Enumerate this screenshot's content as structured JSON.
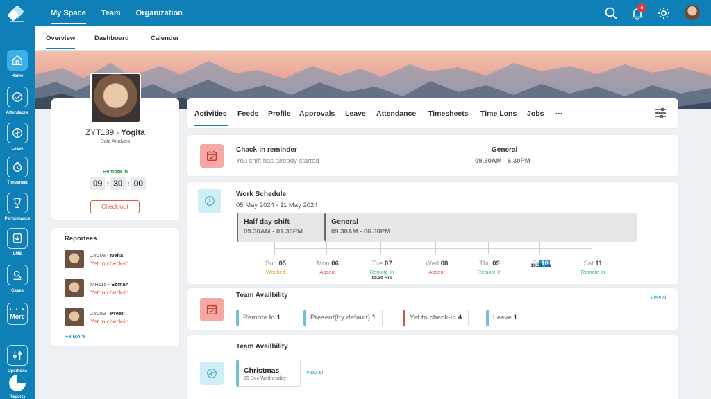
{
  "sidebar": {
    "items": [
      {
        "label": "Home",
        "icon": "home-icon"
      },
      {
        "label": "Attendacne",
        "icon": "attendance-icon"
      },
      {
        "label": "Leave",
        "icon": "leave-icon"
      },
      {
        "label": "Timesheet",
        "icon": "timesheet-icon"
      },
      {
        "label": "Performance",
        "icon": "trophy-icon"
      },
      {
        "label": "LMS",
        "icon": "download-icon"
      },
      {
        "label": "Cases",
        "icon": "cases-icon"
      },
      {
        "label": "More",
        "icon": "more-icon"
      },
      {
        "label": "Opertions",
        "icon": "operations-icon"
      },
      {
        "label": "Reports",
        "icon": "pie-chart-icon"
      }
    ]
  },
  "topnav": {
    "items": [
      "My Space",
      "Team",
      "Organization"
    ],
    "notification_count": "6"
  },
  "subnav": {
    "items": [
      "Overview",
      "Dashboard",
      "Calender"
    ]
  },
  "profile": {
    "id": "ZYT189",
    "separator": " - ",
    "name": "Yogita",
    "role": "Data Analysis",
    "status": "Remote In",
    "clock": {
      "h": "09",
      "m": "30",
      "s": "00"
    },
    "checkout": "Check-out"
  },
  "reportees": {
    "title": "Reportees",
    "people": [
      {
        "id": "ZY208",
        "name": "Neha",
        "status": "Yet to check-in"
      },
      {
        "id": "MH115",
        "name": "Soman",
        "status": "Yet to check-in"
      },
      {
        "id": "ZY289",
        "name": "Preeti",
        "status": "Yet to check-in"
      }
    ],
    "more": "+8 More"
  },
  "tabs": [
    "Activities",
    "Feeds",
    "Profile",
    "Approvals",
    "Leave",
    "Attendance",
    "Timesheets",
    "Time Lons",
    "Jobs",
    "···"
  ],
  "checkin": {
    "title": "Chack-in reminder",
    "subtitle": "You shift has already started",
    "shift_name": "General",
    "shift_time": "09.30AM - 6.30PM"
  },
  "schedule": {
    "title": "Work Schedule",
    "range": "05 May 2024 - 11 May 2024",
    "shifts": [
      {
        "name": "Half day shift",
        "time": "09.30AM - 01.30PM"
      },
      {
        "name": "General",
        "time": "09.30AM - 06.30PM"
      }
    ],
    "days": [
      {
        "dow": "Sun",
        "date": "05",
        "status": "Weeked",
        "hrs": ""
      },
      {
        "dow": "Mon",
        "date": "06",
        "status": "Absent",
        "hrs": ""
      },
      {
        "dow": "Tue",
        "date": "07",
        "status": "Remote In",
        "hrs": "09.30 Hrs"
      },
      {
        "dow": "Wed",
        "date": "08",
        "status": "Absent",
        "hrs": ""
      },
      {
        "dow": "Thu",
        "date": "09",
        "status": "Remote In",
        "hrs": ""
      },
      {
        "dow": "Fri",
        "date": "10",
        "status": "",
        "hrs": "18.30 Hrs"
      },
      {
        "dow": "Sat",
        "date": "11",
        "status": "Remote In",
        "hrs": ""
      }
    ]
  },
  "team": {
    "title": "Team Availbility",
    "view_all": "View all",
    "pills": [
      {
        "label": "Remote In",
        "count": "1"
      },
      {
        "label": "Present(by default)",
        "count": "1"
      },
      {
        "label": "Yet to check-in",
        "count": "4"
      },
      {
        "label": "Leave",
        "count": "1"
      }
    ]
  },
  "holiday": {
    "title": "Team Availbility",
    "name": "Christmas",
    "date": "25 Dec Wednesday",
    "view_all": "View all"
  },
  "colors": {
    "brand": "#0f7fb8",
    "accent": "#1793d1",
    "danger": "#e05a4a",
    "success": "#1e9a4e"
  }
}
